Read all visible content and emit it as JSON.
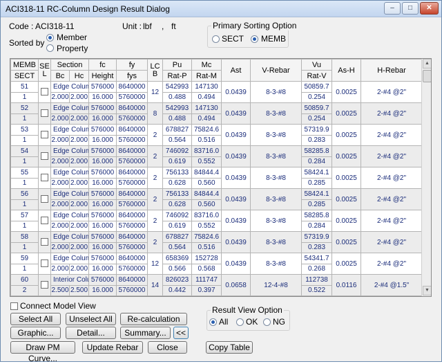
{
  "window": {
    "title": "ACI318-11 RC-Column Design Result Dialog"
  },
  "titlebar_buttons": {
    "minimize": "–",
    "maximize": "□",
    "close": "✕"
  },
  "info": {
    "code": "Code : ACI318-11",
    "unit_label": "Unit :",
    "unit_force": "lbf",
    "unit_sep": ",",
    "unit_length": "ft"
  },
  "sorted_by": {
    "label": "Sorted by",
    "options": [
      "Member",
      "Property"
    ],
    "selected": "Member"
  },
  "sorting_option": {
    "label": "Primary Sorting Option",
    "options": [
      "SECT",
      "MEMB"
    ],
    "selected": "MEMB"
  },
  "grid": {
    "headers": {
      "memb": "MEMB",
      "sect": "SECT",
      "sel": "SE L",
      "section": "Section",
      "bc": "Bc",
      "hc": "Hc",
      "fc": "fc",
      "height": "Height",
      "fy": "fy",
      "fys": "fys",
      "lcb": "LC B",
      "pu": "Pu",
      "ratp": "Rat-P",
      "mc": "Mc",
      "ratm": "Rat-M",
      "ast": "Ast",
      "vrebar": "V-Rebar",
      "vu": "Vu",
      "ratv": "Rat-V",
      "ash": "As-H",
      "hrebar": "H-Rebar"
    },
    "rows": [
      {
        "memb": "51",
        "sect": "1",
        "section": "Edge Column",
        "bc": "2.000",
        "hc": "2.000",
        "fc": "576000",
        "height": "16.000",
        "fy": "8640000",
        "fys": "5760000",
        "lcb": "12",
        "pu": "542993",
        "ratp": "0.488",
        "mc": "147130",
        "ratm": "0.494",
        "ast": "0.0439",
        "vrebar": "8-3-#8",
        "vu": "50859.7",
        "ratv": "0.254",
        "ash": "0.0025",
        "hrebar": "2-#4  @2\""
      },
      {
        "memb": "52",
        "sect": "1",
        "section": "Edge Column",
        "bc": "2.000",
        "hc": "2.000",
        "fc": "576000",
        "height": "16.000",
        "fy": "8640000",
        "fys": "5760000",
        "lcb": "8",
        "pu": "542993",
        "ratp": "0.488",
        "mc": "147130",
        "ratm": "0.494",
        "ast": "0.0439",
        "vrebar": "8-3-#8",
        "vu": "50859.7",
        "ratv": "0.254",
        "ash": "0.0025",
        "hrebar": "2-#4  @2\""
      },
      {
        "memb": "53",
        "sect": "1",
        "section": "Edge Column",
        "bc": "2.000",
        "hc": "2.000",
        "fc": "576000",
        "height": "16.000",
        "fy": "8640000",
        "fys": "5760000",
        "lcb": "2",
        "pu": "678827",
        "ratp": "0.564",
        "mc": "75824.6",
        "ratm": "0.516",
        "ast": "0.0439",
        "vrebar": "8-3-#8",
        "vu": "57319.9",
        "ratv": "0.283",
        "ash": "0.0025",
        "hrebar": "2-#4  @2\""
      },
      {
        "memb": "54",
        "sect": "1",
        "section": "Edge Column",
        "bc": "2.000",
        "hc": "2.000",
        "fc": "576000",
        "height": "16.000",
        "fy": "8640000",
        "fys": "5760000",
        "lcb": "2",
        "pu": "746092",
        "ratp": "0.619",
        "mc": "83716.0",
        "ratm": "0.552",
        "ast": "0.0439",
        "vrebar": "8-3-#8",
        "vu": "58285.8",
        "ratv": "0.284",
        "ash": "0.0025",
        "hrebar": "2-#4  @2\""
      },
      {
        "memb": "55",
        "sect": "1",
        "section": "Edge Column",
        "bc": "2.000",
        "hc": "2.000",
        "fc": "576000",
        "height": "16.000",
        "fy": "8640000",
        "fys": "5760000",
        "lcb": "2",
        "pu": "756133",
        "ratp": "0.628",
        "mc": "84844.4",
        "ratm": "0.560",
        "ast": "0.0439",
        "vrebar": "8-3-#8",
        "vu": "58424.1",
        "ratv": "0.285",
        "ash": "0.0025",
        "hrebar": "2-#4  @2\""
      },
      {
        "memb": "56",
        "sect": "1",
        "section": "Edge Column",
        "bc": "2.000",
        "hc": "2.000",
        "fc": "576000",
        "height": "16.000",
        "fy": "8640000",
        "fys": "5760000",
        "lcb": "2",
        "pu": "756133",
        "ratp": "0.628",
        "mc": "84844.4",
        "ratm": "0.560",
        "ast": "0.0439",
        "vrebar": "8-3-#8",
        "vu": "58424.1",
        "ratv": "0.285",
        "ash": "0.0025",
        "hrebar": "2-#4  @2\""
      },
      {
        "memb": "57",
        "sect": "1",
        "section": "Edge Column",
        "bc": "2.000",
        "hc": "2.000",
        "fc": "576000",
        "height": "16.000",
        "fy": "8640000",
        "fys": "5760000",
        "lcb": "2",
        "pu": "746092",
        "ratp": "0.619",
        "mc": "83716.0",
        "ratm": "0.552",
        "ast": "0.0439",
        "vrebar": "8-3-#8",
        "vu": "58285.8",
        "ratv": "0.284",
        "ash": "0.0025",
        "hrebar": "2-#4  @2\""
      },
      {
        "memb": "58",
        "sect": "1",
        "section": "Edge Column",
        "bc": "2.000",
        "hc": "2.000",
        "fc": "576000",
        "height": "16.000",
        "fy": "8640000",
        "fys": "5760000",
        "lcb": "2",
        "pu": "678827",
        "ratp": "0.564",
        "mc": "75824.6",
        "ratm": "0.516",
        "ast": "0.0439",
        "vrebar": "8-3-#8",
        "vu": "57319.9",
        "ratv": "0.283",
        "ash": "0.0025",
        "hrebar": "2-#4  @2\""
      },
      {
        "memb": "59",
        "sect": "1",
        "section": "Edge Column",
        "bc": "2.000",
        "hc": "2.000",
        "fc": "576000",
        "height": "16.000",
        "fy": "8640000",
        "fys": "5760000",
        "lcb": "12",
        "pu": "658369",
        "ratp": "0.566",
        "mc": "152728",
        "ratm": "0.568",
        "ast": "0.0439",
        "vrebar": "8-3-#8",
        "vu": "54341.7",
        "ratv": "0.268",
        "ash": "0.0025",
        "hrebar": "2-#4  @2\""
      },
      {
        "memb": "60",
        "sect": "2",
        "section": "Interior Colu",
        "bc": "2.500",
        "hc": "2.500",
        "fc": "576000",
        "height": "16.000",
        "fy": "8640000",
        "fys": "5760000",
        "lcb": "14",
        "pu": "826023",
        "ratp": "0.442",
        "mc": "111747",
        "ratm": "0.397",
        "ast": "0.0658",
        "vrebar": "12-4-#8",
        "vu": "112738",
        "ratv": "0.522",
        "ash": "0.0116",
        "hrebar": "2-#4  @1.5\""
      }
    ]
  },
  "connect_model_view": "Connect Model View",
  "buttons": {
    "select_all": "Select All",
    "unselect_all": "Unselect All",
    "recalculation": "Re-calculation",
    "graphic": "Graphic...",
    "detail": "Detail...",
    "summary": "Summary...",
    "collapse": "<<",
    "draw_pm": "Draw PM Curve...",
    "update_rebar": "Update Rebar",
    "close": "Close",
    "copy_table": "Copy Table"
  },
  "result_view": {
    "label": "Result View Option",
    "options": [
      "All",
      "OK",
      "NG"
    ],
    "selected": "All"
  }
}
